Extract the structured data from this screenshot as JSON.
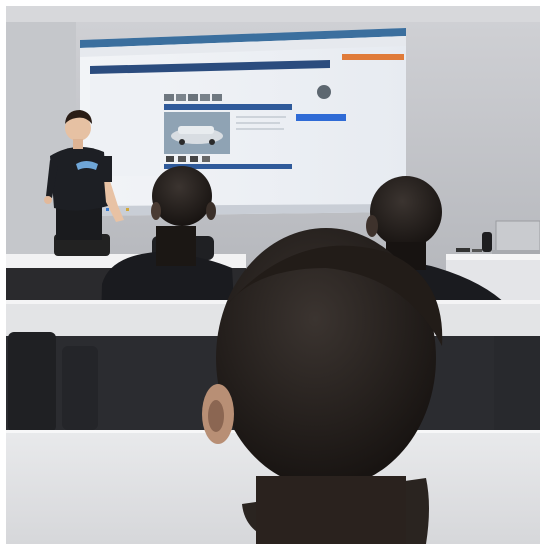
{
  "scene": {
    "projected_page": {
      "headline": "",
      "button": ""
    }
  }
}
